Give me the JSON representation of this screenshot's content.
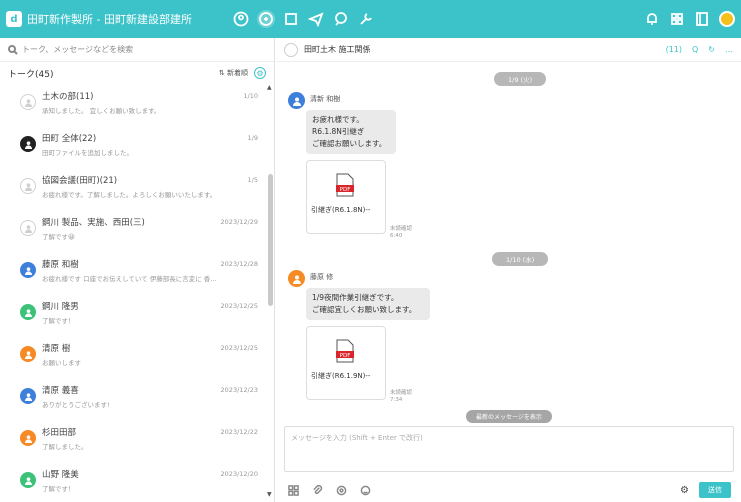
{
  "colors": {
    "accent": "#3cc3c9",
    "send": "#3cc3c9"
  },
  "topbar": {
    "org": "田町新作製所 - 田町新建設部建所",
    "icons": [
      "user-circle-icon",
      "chat-icon",
      "square-icon",
      "send-icon",
      "phone-icon",
      "wrench-icon",
      "bell-icon",
      "grid-icon",
      "notebook-icon"
    ]
  },
  "left": {
    "search_placeholder": "トーク、メッセージなどを検索",
    "talk_header": "トーク(45)",
    "sort_label": "新着順",
    "items": [
      {
        "name": "土木の部(11)",
        "date": "1/10",
        "msg": "承知しました。 宜しくお願い致します。",
        "avatar": "outline"
      },
      {
        "name": "田町 全体(22)",
        "date": "1/9",
        "msg": "田町ファイルを追加しました。",
        "avatar": "dark"
      },
      {
        "name": "協図会議(田町)(21)",
        "date": "1/5",
        "msg": "お疲れ様です。了解しました。よろしくお願いいたします。",
        "avatar": "outline"
      },
      {
        "name": "鋼川 製品、実施、西田(三)",
        "date": "2023/12/29",
        "msg": "了解です😀",
        "avatar": "outline"
      },
      {
        "name": "藤原 和樹",
        "date": "2023/12/28",
        "msg": "お疲れ様です 口座でお伝えしていて 伊藤部長に言変に 香…",
        "avatar": "blue"
      },
      {
        "name": "鋼川 隆男",
        "date": "2023/12/25",
        "msg": "了解です！",
        "avatar": "green"
      },
      {
        "name": "清原 樹",
        "date": "2023/12/25",
        "msg": "お願いします",
        "avatar": "orange"
      },
      {
        "name": "清原 義喜",
        "date": "2023/12/23",
        "msg": "ありがとうございます!",
        "avatar": "blue"
      },
      {
        "name": "杉田田部",
        "date": "2023/12/22",
        "msg": "了解しました。",
        "avatar": "orange"
      },
      {
        "name": "山野 隆美",
        "date": "2023/12/20",
        "msg": "了解です！",
        "avatar": "green"
      }
    ]
  },
  "chat": {
    "title": "田町土木 施工関係",
    "tools": [
      "(11)",
      "Q",
      "↻",
      "…"
    ],
    "date1": "1/9 (火)",
    "date2": "1/10 (水)",
    "msg1": {
      "sender": "清新 和樹",
      "lines": [
        "お疲れ様です。",
        "R6.1.8N引継ぎ",
        "ご確認お願いします。"
      ],
      "file": "引継ぎ(R6.1.8N)--",
      "meta1": "未読確認",
      "meta2": "6:40"
    },
    "msg2": {
      "sender": "藤原 修",
      "lines": [
        "1/9夜間作業引継ぎです。",
        "ご確認宜しくお願い致します。"
      ],
      "file": "引継ぎ(R6.1.9N)--",
      "meta1": "未読確認",
      "meta2": "7:34"
    },
    "new_message": "最新のメッセージを表示",
    "input_placeholder": "メッセージを入力 (Shift + Enter で改行)",
    "send": "送信"
  }
}
